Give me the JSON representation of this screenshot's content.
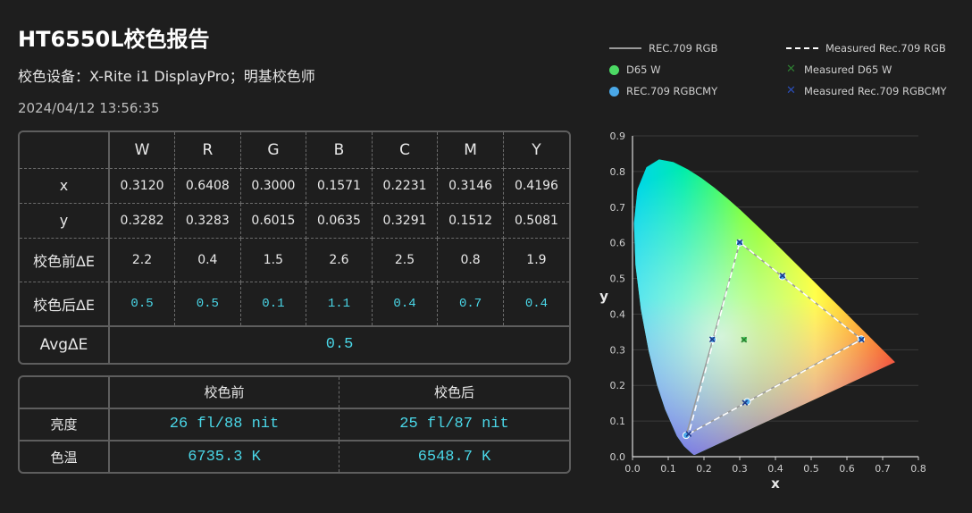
{
  "title": "HT6550L校色报告",
  "device_line": "校色设备：X-Rite i1 DisplayPro；明基校色师",
  "timestamp": "2024/04/12 13:56:35",
  "table": {
    "columns": [
      "W",
      "R",
      "G",
      "B",
      "C",
      "M",
      "Y"
    ],
    "rows": [
      {
        "label": "x",
        "values": [
          "0.3120",
          "0.6408",
          "0.3000",
          "0.1571",
          "0.2231",
          "0.3146",
          "0.4196"
        ]
      },
      {
        "label": "y",
        "values": [
          "0.3282",
          "0.3283",
          "0.6015",
          "0.0635",
          "0.3291",
          "0.1512",
          "0.5081"
        ]
      },
      {
        "label": "校色前ΔE",
        "values": [
          "2.2",
          "0.4",
          "1.5",
          "2.6",
          "2.5",
          "0.8",
          "1.9"
        ]
      },
      {
        "label": "校色后ΔE",
        "values": [
          "0.5",
          "0.5",
          "0.1",
          "1.1",
          "0.4",
          "0.7",
          "0.4"
        ]
      }
    ],
    "avg_label": "AvgΔE",
    "avg_value": "0.5"
  },
  "table2": {
    "headers": [
      "校色前",
      "校色后"
    ],
    "rows": [
      {
        "label": "亮度",
        "before": "26 fl/88 nit",
        "after": "25 fl/87 nit"
      },
      {
        "label": "色温",
        "before": "6735.3 K",
        "after": "6548.7 K"
      }
    ]
  },
  "legend": {
    "rec709_rgb": "REC.709 RGB",
    "measured_rec709_rgb": "Measured Rec.709 RGB",
    "d65w": "D65 W",
    "measured_d65w": "Measured D65 W",
    "rec709_rgbcmy": "REC.709 RGBCMY",
    "measured_rec709_rgbcmy": "Measured Rec.709 RGBCMY"
  },
  "colors": {
    "accent_value": "#4ad7e8",
    "d65_dot": "#4cd964",
    "rgbcmy_dot": "#4aa8e8",
    "measured_d65_x": "#2e7d32",
    "measured_rgbcmy_x": "#1e3a8a"
  },
  "chart_data": {
    "type": "scatter",
    "xlabel": "x",
    "ylabel": "y",
    "xlim": [
      0,
      0.8
    ],
    "ylim": [
      0,
      0.9
    ],
    "xticks": [
      "0.0",
      "0.1",
      "0.2",
      "0.3",
      "0.4",
      "0.5",
      "0.6",
      "0.7",
      "0.8"
    ],
    "yticks": [
      "0.0",
      "0.1",
      "0.2",
      "0.3",
      "0.4",
      "0.5",
      "0.6",
      "0.7",
      "0.8",
      "0.9"
    ],
    "grid": true,
    "series": [
      {
        "name": "REC.709 RGB",
        "points": [
          [
            0.64,
            0.33
          ],
          [
            0.3,
            0.6
          ],
          [
            0.15,
            0.06
          ]
        ]
      },
      {
        "name": "Measured Rec.709 RGB",
        "points": [
          [
            0.6408,
            0.3283
          ],
          [
            0.3,
            0.6015
          ],
          [
            0.1571,
            0.0635
          ]
        ]
      },
      {
        "name": "D65 W",
        "points": [
          [
            0.3127,
            0.329
          ]
        ]
      },
      {
        "name": "Measured D65 W",
        "points": [
          [
            0.312,
            0.3282
          ]
        ]
      },
      {
        "name": "REC.709 RGBCMY",
        "points": [
          [
            0.64,
            0.33
          ],
          [
            0.3,
            0.6
          ],
          [
            0.15,
            0.06
          ],
          [
            0.2246,
            0.3287
          ],
          [
            0.3209,
            0.1542
          ],
          [
            0.4193,
            0.5053
          ]
        ]
      },
      {
        "name": "Measured Rec.709 RGBCMY",
        "points": [
          [
            0.6408,
            0.3283
          ],
          [
            0.3,
            0.6015
          ],
          [
            0.1571,
            0.0635
          ],
          [
            0.2231,
            0.3291
          ],
          [
            0.3146,
            0.1512
          ],
          [
            0.4196,
            0.5081
          ]
        ]
      }
    ]
  }
}
